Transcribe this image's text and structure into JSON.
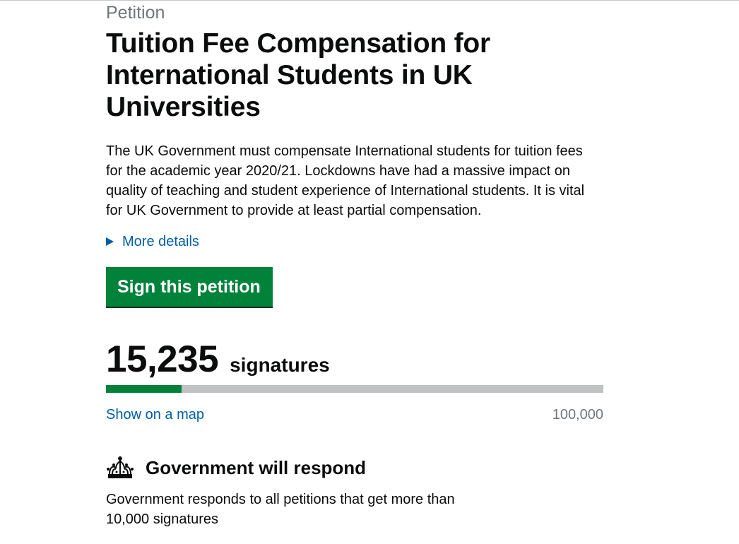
{
  "petition": {
    "caption": "Petition",
    "title": "Tuition Fee Compensation for International Students in UK Universities",
    "summary": "The UK Government must compensate International students for tuition fees for the academic year 2020/21. Lockdowns have had a massive impact on quality of teaching and student experience of International students. It is vital for UK Government to provide at least partial compensation.",
    "more_details_label": "More details",
    "sign_button_label": "Sign this petition"
  },
  "signatures": {
    "count_text": "15,235",
    "label": "signatures",
    "count_value": 15235,
    "goal_value": 100000,
    "goal_text": "100,000",
    "map_link_label": "Show on a map"
  },
  "threshold": {
    "icon": "crown-icon",
    "heading": "Government will respond",
    "text": "Government responds to all petitions that get more than 10,000 signatures"
  },
  "colors": {
    "link": "#005ea5",
    "button": "#00823b",
    "progress_fill": "#00823b",
    "progress_track": "#bfc1c3",
    "secondary_text": "#6f777b"
  }
}
